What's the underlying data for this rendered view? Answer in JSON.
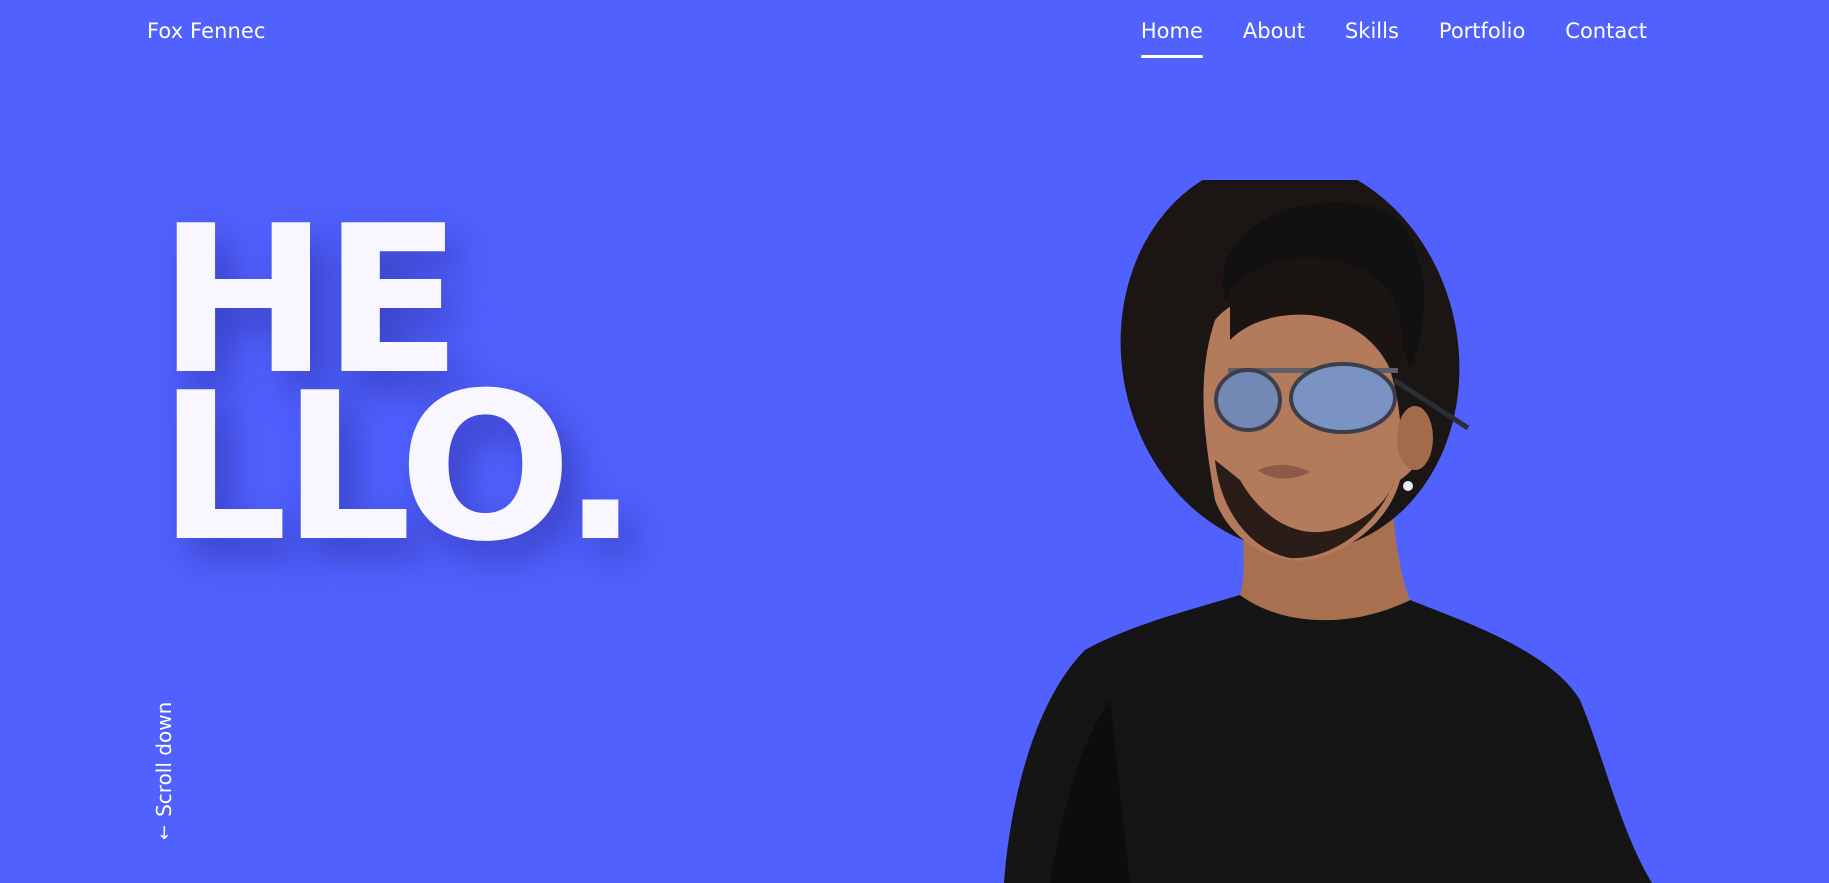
{
  "header": {
    "brand": "Fox Fennec",
    "nav": [
      {
        "label": "Home",
        "active": true
      },
      {
        "label": "About",
        "active": false
      },
      {
        "label": "Skills",
        "active": false
      },
      {
        "label": "Portfolio",
        "active": false
      },
      {
        "label": "Contact",
        "active": false
      }
    ]
  },
  "hero": {
    "line1": "HE",
    "line2": "LLO.",
    "scroll_label": "Scroll down",
    "scroll_icon": "arrow-down-icon",
    "portrait_icon": "portrait-photo"
  },
  "colors": {
    "background": "#5061fe",
    "text": "#ffffff",
    "shirt": "#151515",
    "skin": "#b37a5c"
  }
}
